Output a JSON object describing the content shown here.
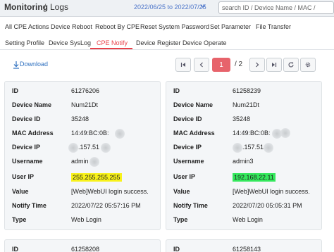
{
  "header": {
    "title": "Monitoring",
    "separator": "/",
    "subtitle": "Logs",
    "date_range": "2022/06/25 to 2022/07/25",
    "search_placeholder": "search ID / Device Name / MAC / "
  },
  "tabs_row1": [
    {
      "label": "All CPE Actions"
    },
    {
      "label": "Device Reboot"
    },
    {
      "label": "Reboot By CPE"
    },
    {
      "label": "Reset System Password"
    },
    {
      "label": "Set Parameter"
    },
    {
      "label": "File Transfer"
    }
  ],
  "tabs_row2": [
    {
      "label": "Setting Profile"
    },
    {
      "label": "Device SysLog"
    },
    {
      "label": "CPE Notify",
      "active": true
    },
    {
      "label": "Device Register"
    },
    {
      "label": "Device Operate"
    }
  ],
  "toolbar": {
    "download_label": "Download",
    "current_page": "1",
    "total_pages": "/ 2"
  },
  "labels": {
    "id": "ID",
    "device_name": "Device Name",
    "device_id": "Device ID",
    "mac": "MAC Address",
    "device_ip": "Device IP",
    "username": "Username",
    "user_ip": "User IP",
    "value": "Value",
    "notify_time": "Notify Time",
    "type": "Type"
  },
  "cards": [
    {
      "id": "61276206",
      "device_name": "Num21Dt",
      "device_id": "35248",
      "mac": "14:49:BC:0B:",
      "device_ip": ".157.51",
      "username": "admin",
      "user_ip": "255.255.255.255",
      "value": "[Web]WebUI login success.",
      "notify_time": "2022/07/22 05:57:16 PM",
      "type": "Web Login"
    },
    {
      "id": "61258239",
      "device_name": "Num21Dt",
      "device_id": "35248",
      "mac": "14:49:BC:0B:",
      "device_ip": ".157.51",
      "username": "admin3",
      "user_ip": "192.168.22.11",
      "value": "[Web]WebUI login success.",
      "notify_time": "2022/07/20 05:05:31 PM",
      "type": "Web Login"
    },
    {
      "id": "61258208"
    },
    {
      "id": "61258143"
    }
  ],
  "colors": {
    "accent": "#e8404a",
    "link": "#2d6fbf",
    "highlight_yellow": "#f8f21a",
    "highlight_green": "#34e85c"
  }
}
